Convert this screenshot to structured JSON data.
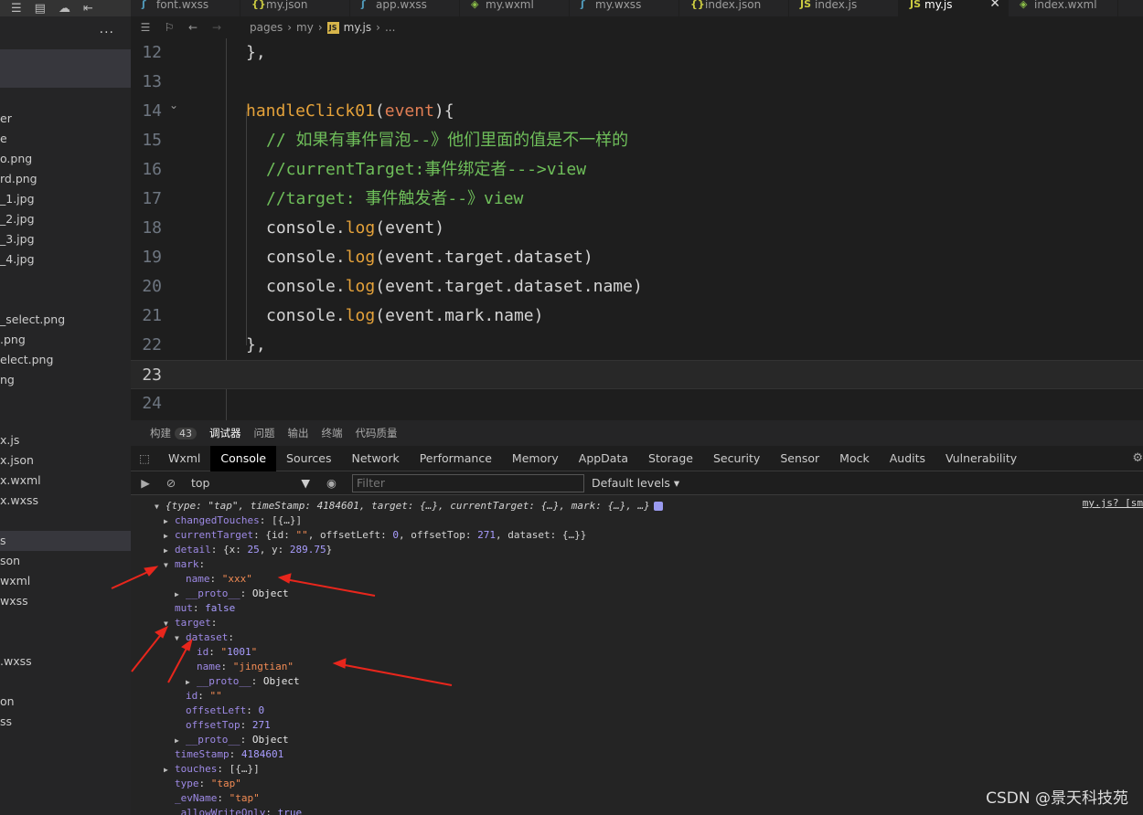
{
  "explorer": {
    "more": "...",
    "items": [
      "er",
      "e",
      "o.png",
      "rd.png",
      "_1.jpg",
      "_2.jpg",
      "_3.jpg",
      "_4.jpg",
      "_select.png",
      ".png",
      "elect.png",
      "ng",
      "x.js",
      "x.json",
      "x.wxml",
      "x.wxss",
      "s",
      "son",
      "wxml",
      "wxss",
      ".wxss",
      "on",
      "ss"
    ]
  },
  "tabs": [
    {
      "icon": "css",
      "label": "font.wxss"
    },
    {
      "icon": "json",
      "label": "my.json"
    },
    {
      "icon": "css",
      "label": "app.wxss"
    },
    {
      "icon": "wxml",
      "label": "my.wxml"
    },
    {
      "icon": "css",
      "label": "my.wxss"
    },
    {
      "icon": "json",
      "label": "index.json"
    },
    {
      "icon": "js",
      "label": "index.js"
    },
    {
      "icon": "js",
      "label": "my.js",
      "active": true
    },
    {
      "icon": "wxml",
      "label": "index.wxml"
    }
  ],
  "breadcrumb": {
    "parts": [
      "pages",
      "my",
      "my.js",
      "..."
    ]
  },
  "editor": {
    "lines": [
      {
        "n": "12",
        "text": "},"
      },
      {
        "n": "13",
        "text": ""
      },
      {
        "n": "14",
        "text": "handleClick01(event){"
      },
      {
        "n": "15",
        "text": "// 如果有事件冒泡--》他们里面的值是不一样的"
      },
      {
        "n": "16",
        "text": "//currentTarget:事件绑定者--->view"
      },
      {
        "n": "17",
        "text": "//target: 事件触发者--》view"
      },
      {
        "n": "18",
        "text": "console.log(event)"
      },
      {
        "n": "19",
        "text": "console.log(event.target.dataset)"
      },
      {
        "n": "20",
        "text": "console.log(event.target.dataset.name)"
      },
      {
        "n": "21",
        "text": "console.log(event.mark.name)"
      },
      {
        "n": "22",
        "text": "},"
      },
      {
        "n": "23",
        "text": ""
      },
      {
        "n": "24",
        "text": ""
      }
    ]
  },
  "panel_tabs": {
    "build": "构建",
    "build_count": "43",
    "debugger": "调试器",
    "problems": "问题",
    "output": "输出",
    "terminal": "终端",
    "quality": "代码质量"
  },
  "devtools_tabs": [
    "Wxml",
    "Console",
    "Sources",
    "Network",
    "Performance",
    "Memory",
    "AppData",
    "Storage",
    "Security",
    "Sensor",
    "Mock",
    "Audits",
    "Vulnerability"
  ],
  "console_toolbar": {
    "context": "top",
    "filter_placeholder": "Filter",
    "levels": "Default levels"
  },
  "console": {
    "source": "my.js? [sm",
    "summary": "{type: \"tap\", timeStamp: 4184601, target: {…}, currentTarget: {…}, mark: {…}, …}",
    "rows": [
      "changedTouches: [{…}]",
      "currentTarget: {id: \"\", offsetLeft: 0, offsetTop: 271, dataset: {…}}",
      "detail: {x: 25, y: 289.75}",
      "mark:",
      "name: \"xxx\"",
      "__proto__: Object",
      "mut: false",
      "target:",
      "dataset:",
      "id: \"1001\"",
      "name: \"jingtian\"",
      "__proto__: Object",
      "id: \"\"",
      "offsetLeft: 0",
      "offsetTop: 271",
      "__proto__: Object",
      "timeStamp: 4184601",
      "touches: [{…}]",
      "type: \"tap\"",
      "_evName: \"tap\"",
      "_allowWriteOnly: true"
    ]
  },
  "watermark": "CSDN @景天科技苑",
  "colors": {
    "arrow": "#e8261c",
    "active_tab": "#000000",
    "comment": "#6fbf5a",
    "function": "#e5a23a"
  }
}
